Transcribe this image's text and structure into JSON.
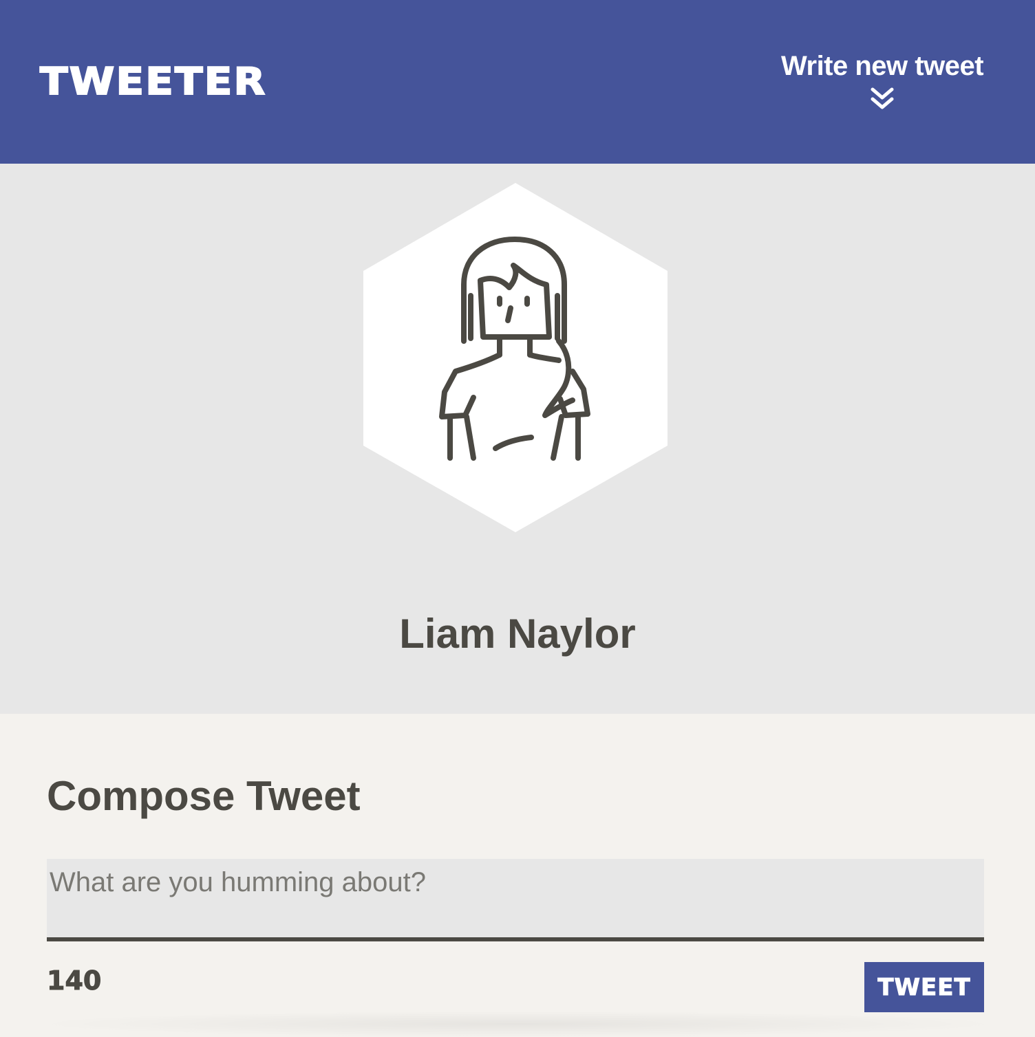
{
  "header": {
    "brand": "TWEETER",
    "write_toggle_label": "Write new tweet",
    "write_toggle_icon": "chevron-double-down-icon"
  },
  "profile": {
    "name": "Liam Naylor",
    "avatar_icon": "person-avatar-icon"
  },
  "compose": {
    "title": "Compose Tweet",
    "placeholder": "What are you humming about?",
    "value": "",
    "char_count": "140",
    "submit_label": "TWEET"
  },
  "colors": {
    "brand": "#45549a",
    "text": "#4b4943",
    "panel": "#e7e7e7",
    "background": "#f4f2ee"
  }
}
